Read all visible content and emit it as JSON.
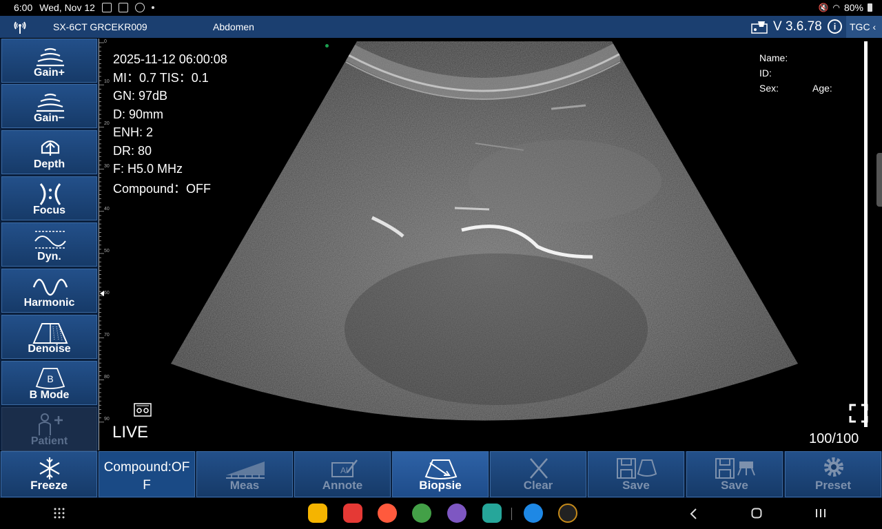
{
  "status_bar": {
    "time": "6:00",
    "date": "Wed, Nov 12",
    "battery": "80%"
  },
  "title_bar": {
    "device": "SX-6CT GRCEKR009",
    "preset": "Abdomen",
    "version": "V 3.6.78",
    "info": "i",
    "tgc": "TGC ‹"
  },
  "sidebar": {
    "items": [
      {
        "label": "Gain+",
        "icon": "gain-plus-icon"
      },
      {
        "label": "Gain−",
        "icon": "gain-minus-icon"
      },
      {
        "label": "Depth",
        "icon": "depth-icon"
      },
      {
        "label": "Focus",
        "icon": "focus-icon"
      },
      {
        "label": "Dyn.",
        "icon": "dynamic-range-icon"
      },
      {
        "label": "Harmonic",
        "icon": "harmonic-icon"
      },
      {
        "label": "Denoise",
        "icon": "denoise-icon"
      },
      {
        "label": "B Mode",
        "icon": "b-mode-icon",
        "icon_text": "B"
      },
      {
        "label": "Patient",
        "icon": "patient-icon",
        "disabled": true
      }
    ]
  },
  "ruler": {
    "ticks": [
      "0",
      "10",
      "20",
      "30",
      "40",
      "50",
      "60",
      "70",
      "80",
      "90"
    ]
  },
  "params": {
    "datetime": "2025-11-12 06:00:08",
    "mi_tis": "MI：0.7  TIS：0.1",
    "gain": "GN: 97dB",
    "depth": "D: 90mm",
    "enh": "ENH: 2",
    "dr": "DR: 80",
    "freq": "F: H5.0 MHz",
    "compound": "Compound：OFF"
  },
  "patient": {
    "name": "Name:",
    "id": "ID:",
    "sex": "Sex:",
    "age": "Age:"
  },
  "live": "LIVE",
  "frame_count": "100/100",
  "toolbar": {
    "freeze": "Freeze",
    "compound_line1": "Compound:OF",
    "compound_line2": "F",
    "meas": "Meas",
    "annote": "Annote",
    "biopsie": "Biopsie",
    "clear": "Clear",
    "save_image": "Save",
    "save_video": "Save",
    "preset": "Preset"
  },
  "colors": {
    "title_bar": "#1b3f70",
    "button": "#23508a",
    "sidebar_bg": "#0a1f3d"
  }
}
